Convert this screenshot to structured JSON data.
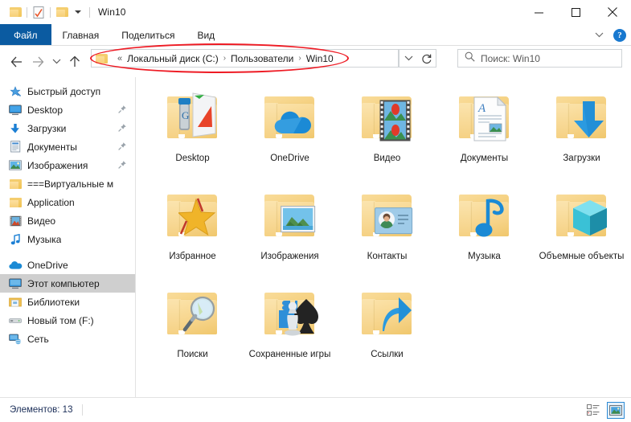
{
  "window": {
    "title": "Win10",
    "quick_access": [
      {
        "name": "folder-icon",
        "label": "Свойства папки"
      },
      {
        "name": "properties-icon",
        "label": "Свойства"
      },
      {
        "name": "new-folder-icon",
        "label": "Создать папку"
      }
    ],
    "controls": {
      "minimize": "Свернуть",
      "maximize": "Развернуть",
      "close": "Закрыть"
    }
  },
  "ribbon": {
    "tabs": [
      {
        "id": "file",
        "label": "Файл"
      },
      {
        "id": "home",
        "label": "Главная"
      },
      {
        "id": "share",
        "label": "Поделиться"
      },
      {
        "id": "view",
        "label": "Вид"
      }
    ],
    "collapse_label": "Свернуть ленту",
    "help_label": "?"
  },
  "navigation": {
    "back_label": "Назад",
    "forward_label": "Вперед",
    "recent_label": "Последние расположения",
    "up_label": "Вверх",
    "address": {
      "prefix": "«",
      "crumbs": [
        "Локальный диск (C:)",
        "Пользователи",
        "Win10"
      ],
      "separator": "›",
      "dropdown_label": "Предыдущие расположения",
      "refresh_label": "Обновить"
    },
    "search": {
      "placeholder": "Поиск: Win10",
      "value": ""
    },
    "annotation_color": "#ee1b24"
  },
  "sidebar": {
    "items": [
      {
        "label": "Быстрый доступ",
        "icon": "star-pin-icon",
        "pinned": false,
        "selected": false,
        "indent": 0
      },
      {
        "label": "Desktop",
        "icon": "desktop-icon",
        "pinned": true,
        "selected": false,
        "indent": 1
      },
      {
        "label": "Загрузки",
        "icon": "downloads-icon",
        "pinned": true,
        "selected": false,
        "indent": 1
      },
      {
        "label": "Документы",
        "icon": "documents-icon",
        "pinned": true,
        "selected": false,
        "indent": 1
      },
      {
        "label": "Изображения",
        "icon": "pictures-icon",
        "pinned": true,
        "selected": false,
        "indent": 1
      },
      {
        "label": "===Виртуальные м",
        "icon": "folder-icon",
        "pinned": false,
        "selected": false,
        "indent": 1
      },
      {
        "label": "Application",
        "icon": "folder-icon",
        "pinned": false,
        "selected": false,
        "indent": 1
      },
      {
        "label": "Видео",
        "icon": "video-icon",
        "pinned": false,
        "selected": false,
        "indent": 1
      },
      {
        "label": "Музыка",
        "icon": "music-icon",
        "pinned": false,
        "selected": false,
        "indent": 1
      },
      {
        "label": "OneDrive",
        "icon": "onedrive-icon",
        "pinned": false,
        "selected": false,
        "indent": 0
      },
      {
        "label": "Этот компьютер",
        "icon": "computer-icon",
        "pinned": false,
        "selected": true,
        "indent": 0
      },
      {
        "label": "Библиотеки",
        "icon": "libraries-icon",
        "pinned": false,
        "selected": false,
        "indent": 0
      },
      {
        "label": "Новый том (F:)",
        "icon": "drive-icon",
        "pinned": false,
        "selected": false,
        "indent": 0
      },
      {
        "label": "Сеть",
        "icon": "network-icon",
        "pinned": false,
        "selected": false,
        "indent": 0
      }
    ]
  },
  "content": {
    "items": [
      {
        "label": "Desktop",
        "icon": "folder-desktop-icon"
      },
      {
        "label": "OneDrive",
        "icon": "folder-onedrive-icon"
      },
      {
        "label": "Видео",
        "icon": "folder-video-icon"
      },
      {
        "label": "Документы",
        "icon": "folder-documents-icon"
      },
      {
        "label": "Загрузки",
        "icon": "folder-downloads-icon"
      },
      {
        "label": "Избранное",
        "icon": "folder-favorites-icon"
      },
      {
        "label": "Изображения",
        "icon": "folder-pictures-icon"
      },
      {
        "label": "Контакты",
        "icon": "folder-contacts-icon"
      },
      {
        "label": "Музыка",
        "icon": "folder-music-icon"
      },
      {
        "label": "Объемные объекты",
        "icon": "folder-3dobjects-icon"
      },
      {
        "label": "Поиски",
        "icon": "folder-searches-icon"
      },
      {
        "label": "Сохраненные игры",
        "icon": "folder-savedgames-icon"
      },
      {
        "label": "Ссылки",
        "icon": "folder-links-icon"
      }
    ]
  },
  "status": {
    "items_count_text": "Элементов: 13",
    "views": [
      {
        "id": "details",
        "label": "Таблица",
        "active": false
      },
      {
        "id": "large-icons",
        "label": "Крупные значки",
        "active": true
      }
    ]
  },
  "colors": {
    "accent": "#0b5ba1",
    "folder": "#f3cc76",
    "annotation": "#ee1b24",
    "selection": "#cfcfcf",
    "onedrive_blue": "#1a8ad5"
  }
}
